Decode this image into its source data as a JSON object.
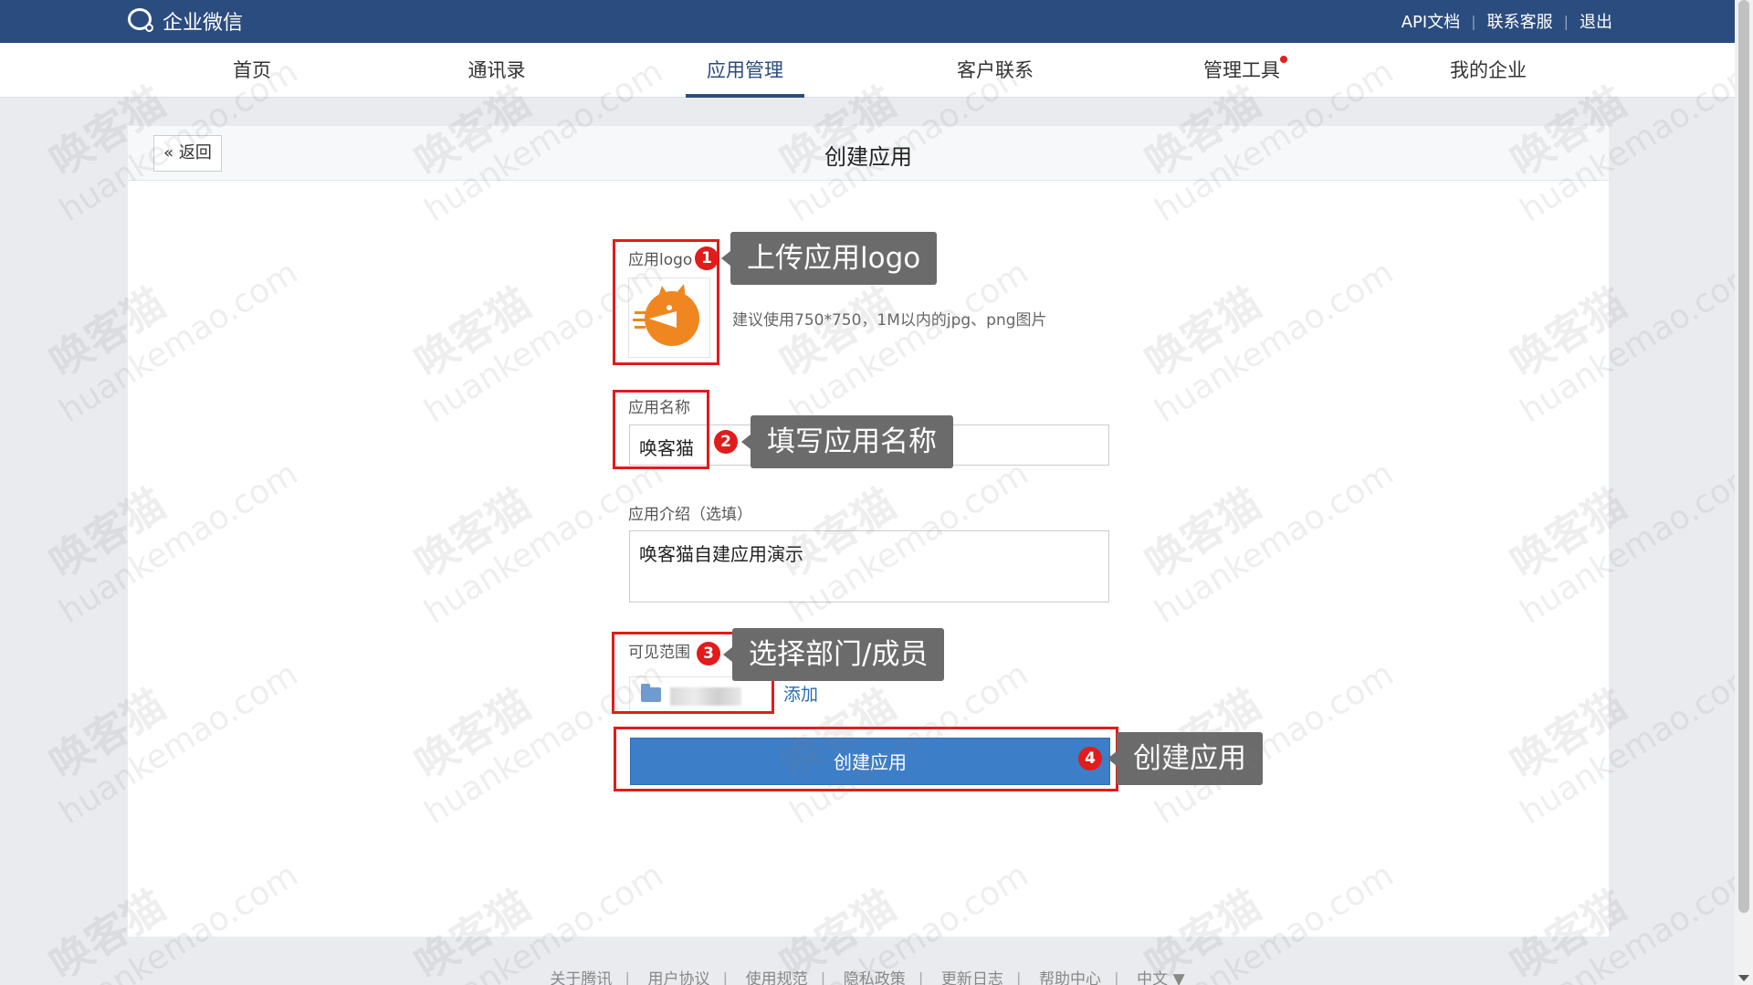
{
  "topbar": {
    "brand": "企业微信",
    "links": [
      "API文档",
      "联系客服",
      "退出"
    ]
  },
  "nav": {
    "tabs": [
      {
        "label": "首页"
      },
      {
        "label": "通讯录"
      },
      {
        "label": "应用管理",
        "active": true
      },
      {
        "label": "客户联系"
      },
      {
        "label": "管理工具",
        "has_notification": true
      },
      {
        "label": "我的企业"
      }
    ]
  },
  "page": {
    "back_label": "返回",
    "title": "创建应用"
  },
  "form": {
    "logo_label": "应用logo",
    "logo_hint": "建议使用750*750，1M以内的jpg、png图片",
    "name_label": "应用名称",
    "name_value": "唤客猫",
    "intro_label": "应用介绍（选填）",
    "intro_value": "唤客猫自建应用演示",
    "scope_label": "可见范围",
    "add_label": "添加",
    "submit_label": "创建应用"
  },
  "annotations": [
    {
      "number": "1",
      "text": "上传应用logo"
    },
    {
      "number": "2",
      "text": "填写应用名称"
    },
    {
      "number": "3",
      "text": "选择部门/成员"
    },
    {
      "number": "4",
      "text": "创建应用"
    }
  ],
  "footer": {
    "links": [
      "关于腾讯",
      "用户协议",
      "使用规范",
      "隐私政策",
      "更新日志",
      "帮助中心",
      "中文 ▼"
    ]
  },
  "watermark": {
    "cn": "唤客猫",
    "en": "huankemao.com"
  },
  "colors": {
    "topbar": "#2b4c7e",
    "primary_button": "#3d7ec8",
    "annotation_red": "#e21b1b",
    "callout_bg": "#6b6b6b",
    "logo_orange": "#f0861f"
  }
}
